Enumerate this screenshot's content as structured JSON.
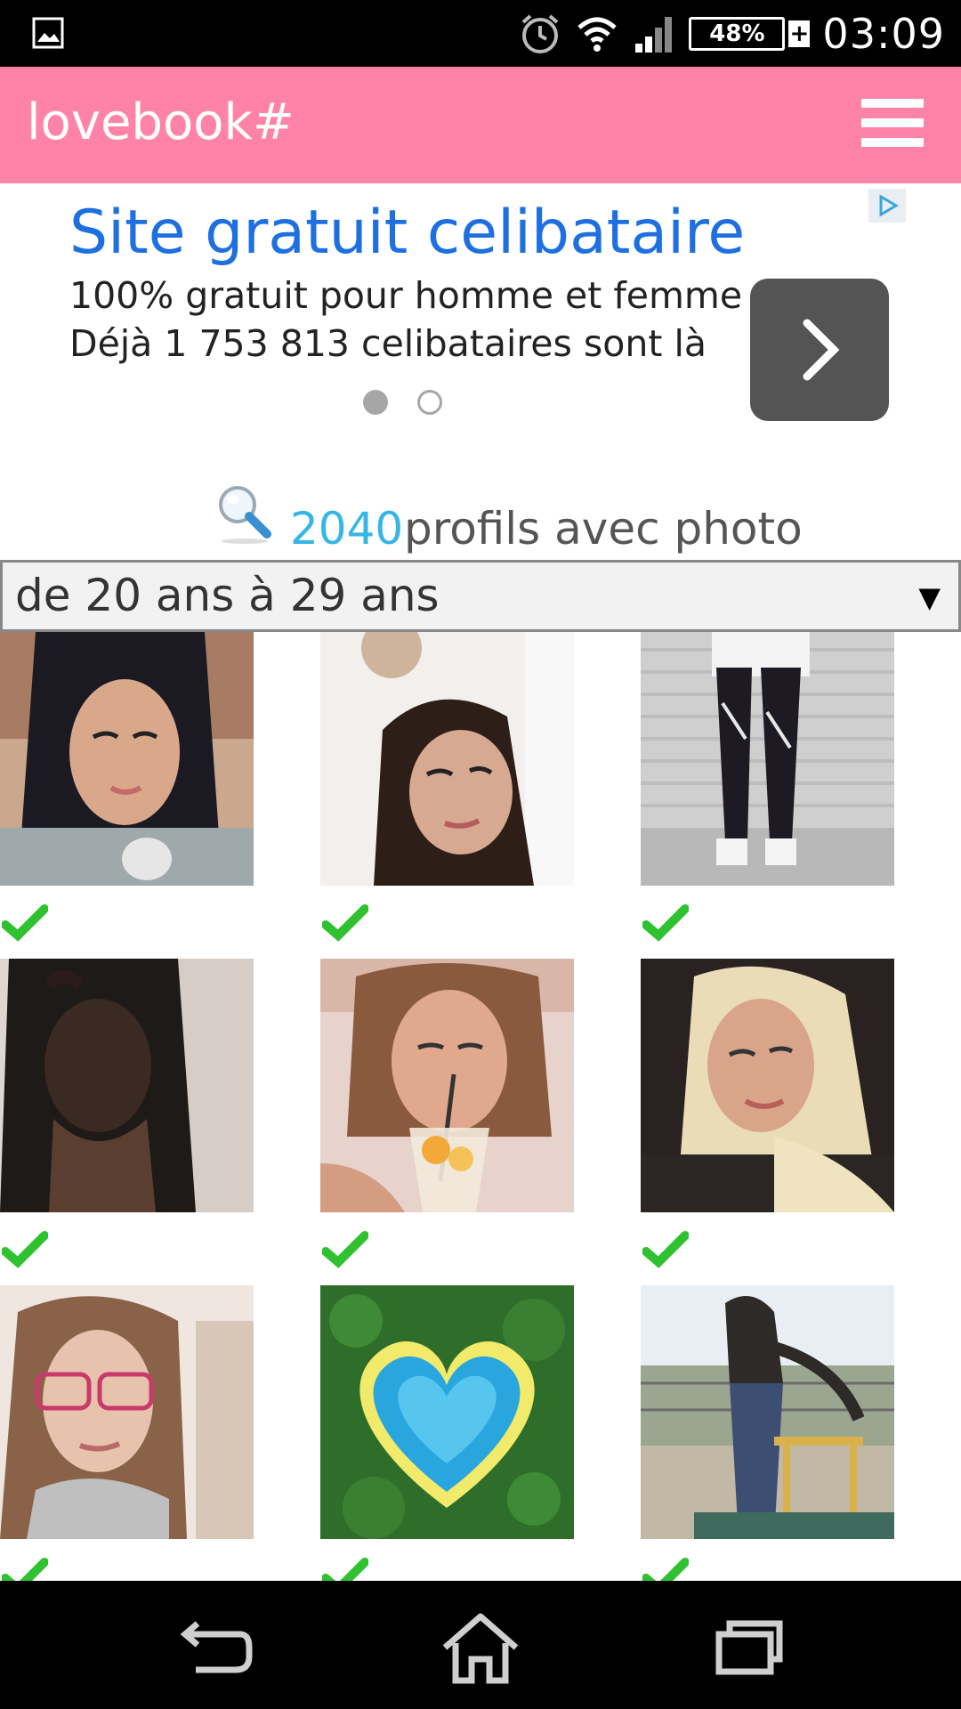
{
  "status_bar": {
    "icons": [
      "gallery-icon",
      "alarm-icon",
      "wifi-icon",
      "signal-icon",
      "battery-icon"
    ],
    "battery_level": "48%",
    "battery_plus": "+",
    "time": "03:09"
  },
  "app_bar": {
    "title": "lovebook#",
    "menu_icon": "hamburger-menu-icon"
  },
  "ad": {
    "title": "Site gratuit celibataire",
    "line1": "100% gratuit pour homme et femme",
    "line2": "Déjà 1 753 813 celibataires sont là",
    "choices_icon": "adchoices-icon",
    "go_icon": "chevron-right-icon",
    "pager_dots": 2,
    "active_dot": 0
  },
  "search_summary": {
    "icon": "magnifier-icon",
    "count": "2040",
    "text": "profils avec photo"
  },
  "age_filter": {
    "selected": "de 20 ans à 29 ans",
    "arrow": "▼"
  },
  "profiles": [
    {
      "photo": "woman-dark-hair-selfie",
      "verified": true
    },
    {
      "photo": "woman-brown-hair-tilted",
      "verified": true
    },
    {
      "photo": "legs-leggings-sneakers",
      "verified": true
    },
    {
      "photo": "woman-black-top",
      "verified": true
    },
    {
      "photo": "woman-drinking-straw",
      "verified": true
    },
    {
      "photo": "woman-blonde-hair",
      "verified": true
    },
    {
      "photo": "woman-glasses",
      "verified": true
    },
    {
      "photo": "heart-shaped-lagoon",
      "verified": true
    },
    {
      "photo": "woman-playground",
      "verified": true
    }
  ],
  "nav_bar": {
    "icons": [
      "back-icon",
      "home-icon",
      "recents-icon"
    ]
  },
  "colors": {
    "app_bar": "#ff82a9",
    "ad_title": "#1e6fe0",
    "count": "#35b6e6",
    "check": "#2fc12f"
  }
}
